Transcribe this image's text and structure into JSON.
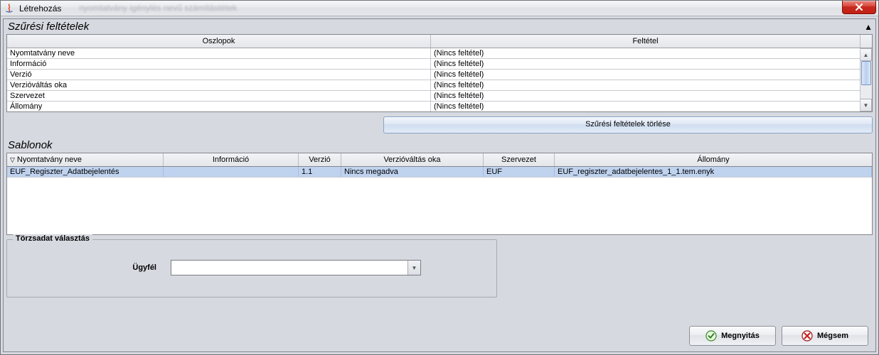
{
  "window": {
    "title": "Létrehozás",
    "blurred_hint": "nyomtatvány igénylés nevű számítástétek"
  },
  "filter": {
    "section_title": "Szűrési feltételek",
    "headers": {
      "column": "Oszlopok",
      "condition": "Feltétel"
    },
    "rows": [
      {
        "column": "Nyomtatvány neve",
        "condition": "(Nincs feltétel)"
      },
      {
        "column": "Információ",
        "condition": "(Nincs feltétel)"
      },
      {
        "column": "Verzió",
        "condition": "(Nincs feltétel)"
      },
      {
        "column": "Verzióváltás oka",
        "condition": "(Nincs feltétel)"
      },
      {
        "column": "Szervezet",
        "condition": "(Nincs feltétel)"
      },
      {
        "column": "Állomány",
        "condition": "(Nincs feltétel)"
      }
    ],
    "clear_button": "Szűrési feltételek törlése"
  },
  "templates": {
    "section_title": "Sablonok",
    "sort_indicator": "▽",
    "headers": {
      "name": "Nyomtatvány neve",
      "info": "Információ",
      "version": "Verzió",
      "reason": "Verzióváltás oka",
      "org": "Szervezet",
      "file": "Állomány"
    },
    "rows": [
      {
        "name": "EUF_Regiszter_Adatbejelentés",
        "info": "",
        "version": "1.1",
        "reason": "Nincs megadva",
        "org": "EUF",
        "file": "EUF_regiszter_adatbejelentes_1_1.tem.enyk"
      }
    ]
  },
  "masterdata": {
    "legend": "Törzsadat választás",
    "customer_label": "Ügyfél",
    "customer_value": ""
  },
  "buttons": {
    "open": "Megnyitás",
    "cancel": "Mégsem"
  }
}
